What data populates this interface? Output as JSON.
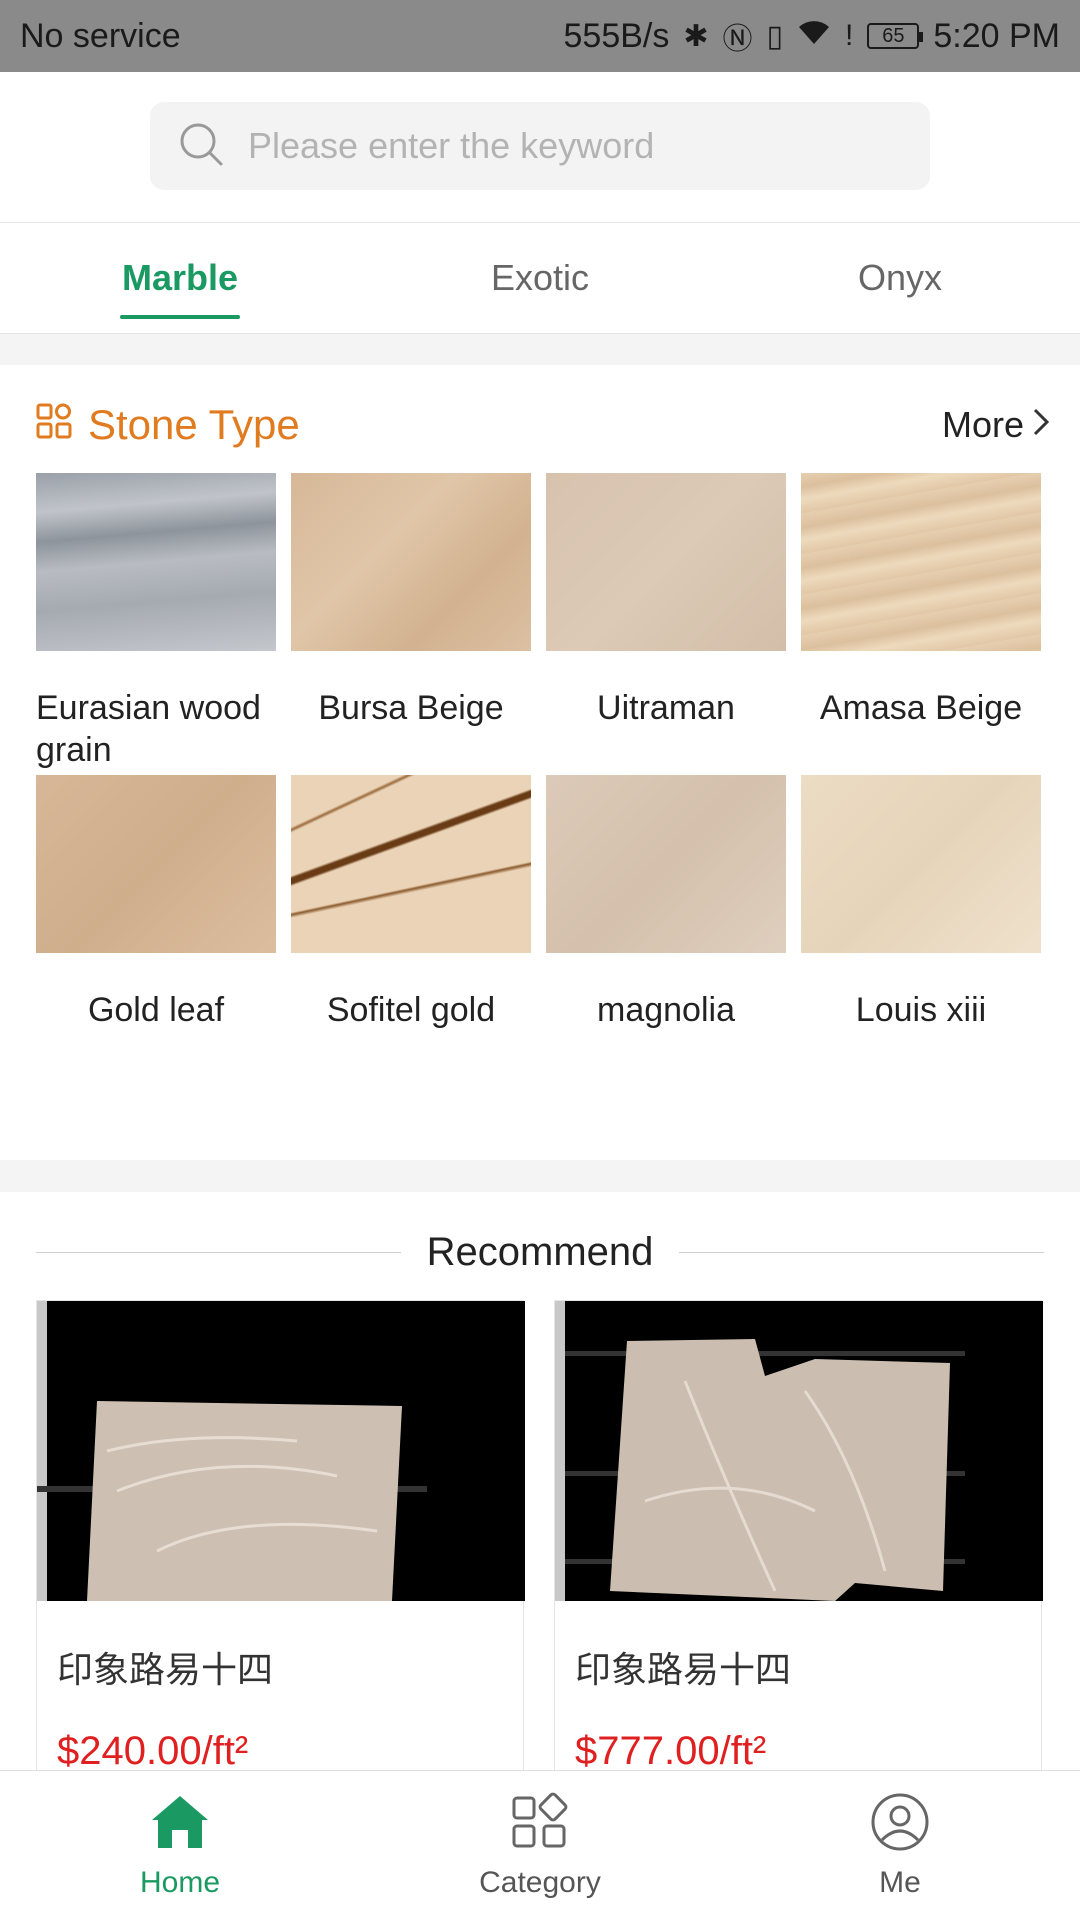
{
  "status_bar": {
    "carrier": "No service",
    "net_speed": "555B/s",
    "battery": "65",
    "time": "5:20 PM",
    "icons": [
      "bluetooth-icon",
      "nfc-icon",
      "vibrate-icon",
      "wifi-icon",
      "alert-icon",
      "battery-icon"
    ]
  },
  "search": {
    "placeholder": "Please enter the keyword"
  },
  "tabs": [
    {
      "label": "Marble"
    },
    {
      "label": "Exotic"
    },
    {
      "label": "Onyx"
    }
  ],
  "stone_type": {
    "title": "Stone Type",
    "more": "More",
    "items": [
      {
        "label": "Eurasian wood grain"
      },
      {
        "label": "Bursa Beige"
      },
      {
        "label": "Uitraman"
      },
      {
        "label": "Amasa Beige"
      },
      {
        "label": "Gold leaf"
      },
      {
        "label": "Sofitel gold"
      },
      {
        "label": "magnolia"
      },
      {
        "label": "Louis xiii"
      }
    ]
  },
  "recommend": {
    "title": "Recommend",
    "products": [
      {
        "name": "印象路易十四",
        "price": "$240.00/ft²"
      },
      {
        "name": "印象路易十四",
        "price": "$777.00/ft²"
      }
    ]
  },
  "bottom_nav": [
    {
      "label": "Home",
      "icon": "home-icon",
      "active": true
    },
    {
      "label": "Category",
      "icon": "category-icon",
      "active": false
    },
    {
      "label": "Me",
      "icon": "profile-icon",
      "active": false
    }
  ],
  "colors": {
    "accent": "#1a9a62",
    "section_title": "#e07b1f",
    "price": "#e02020"
  }
}
